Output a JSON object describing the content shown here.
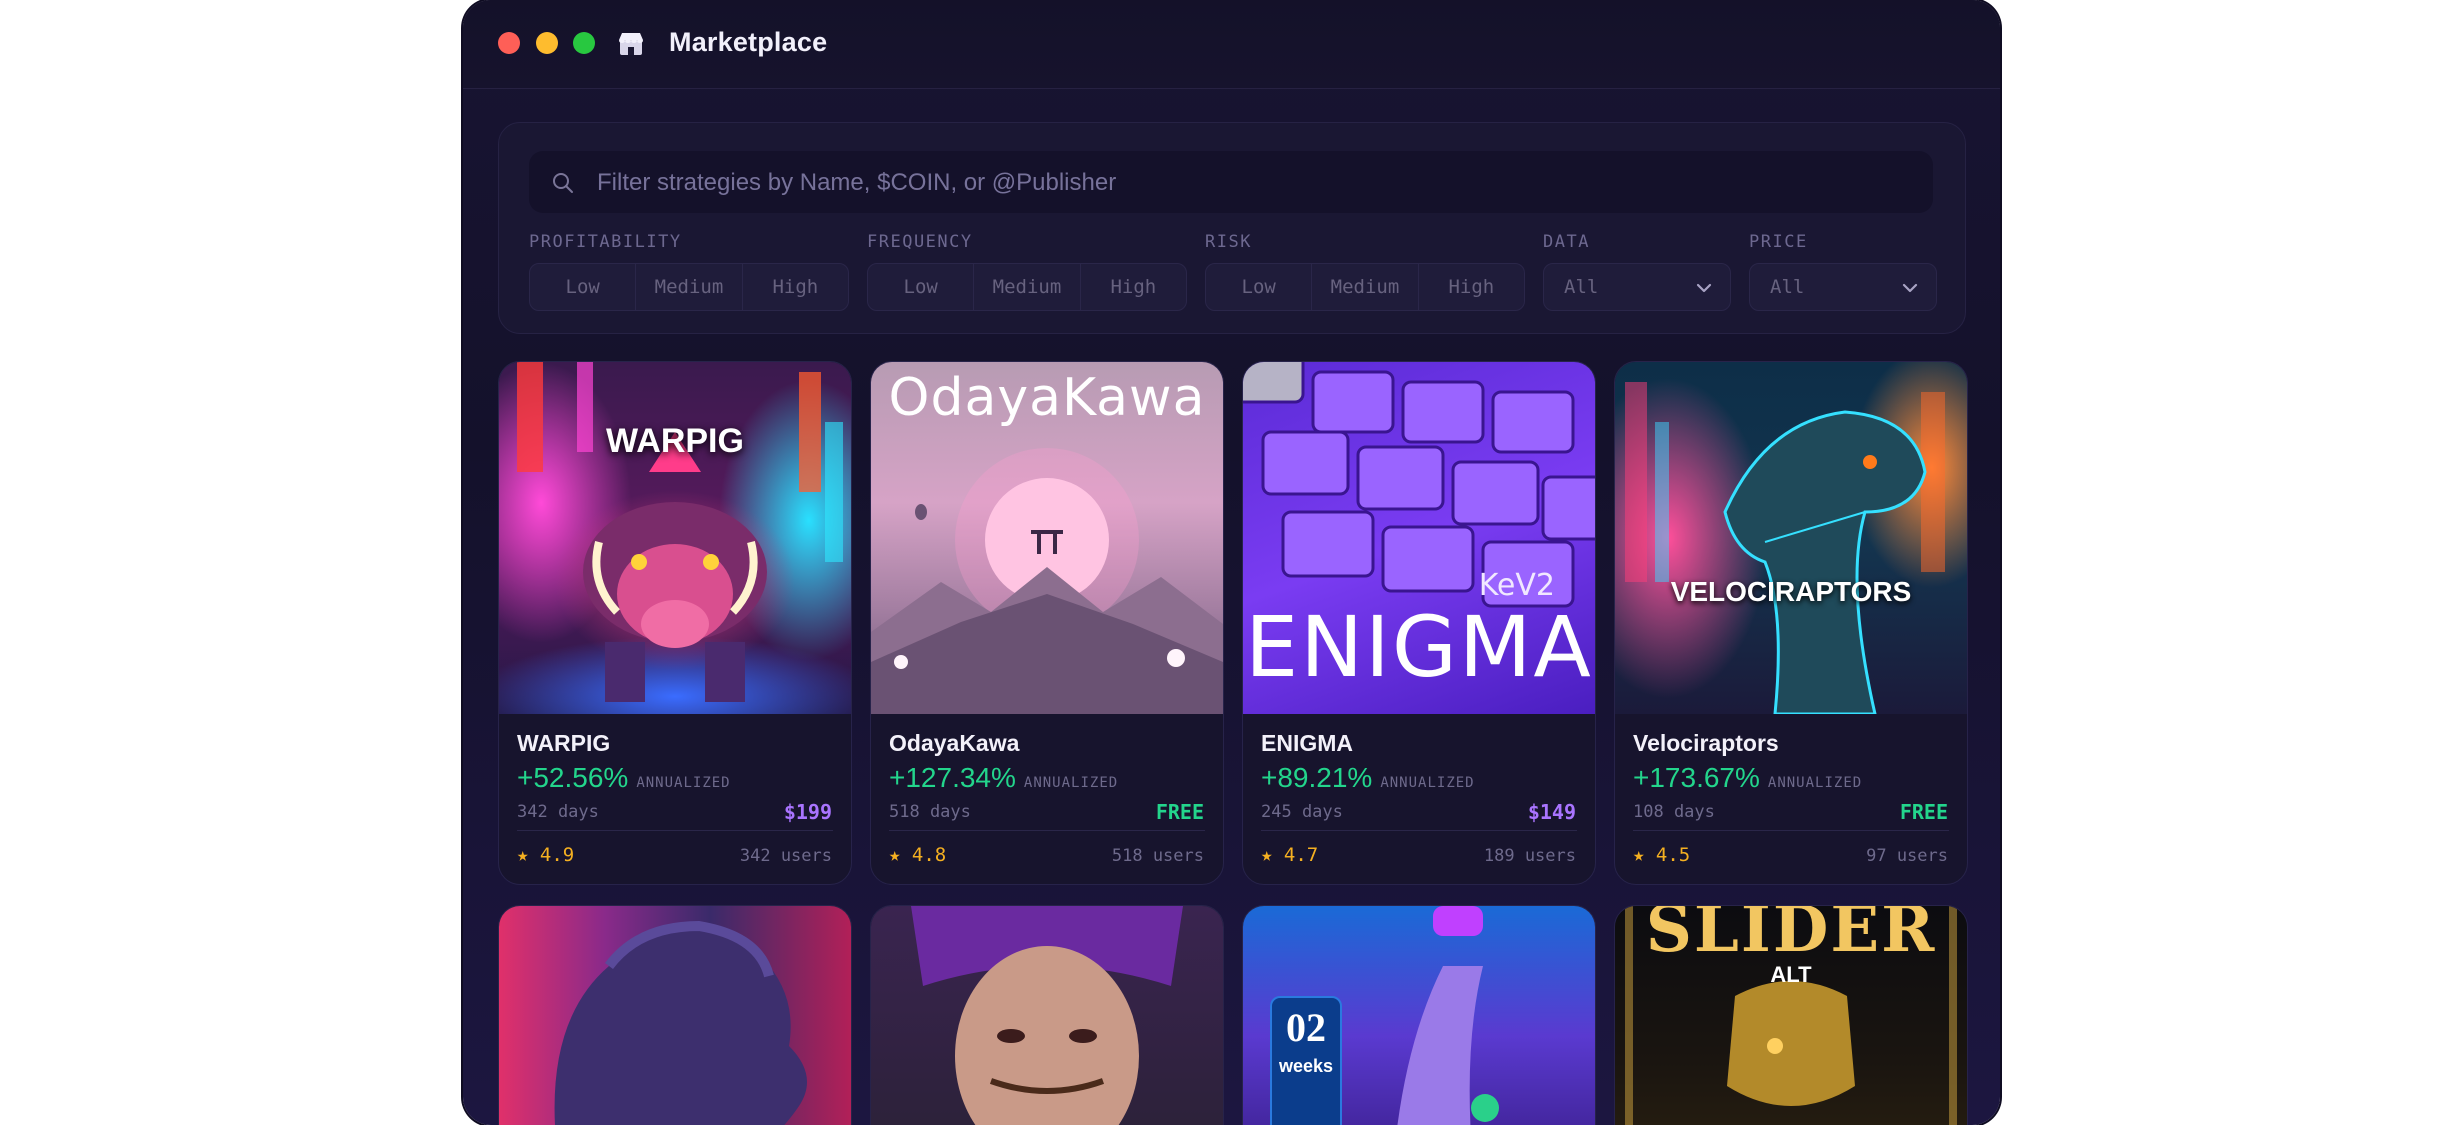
{
  "window": {
    "title": "Marketplace",
    "icon": "store-icon"
  },
  "search": {
    "placeholder": "Filter strategies by Name, $COIN, or @Publisher"
  },
  "filters": {
    "profitability": {
      "label": "PROFITABILITY",
      "options": [
        "Low",
        "Medium",
        "High"
      ]
    },
    "frequency": {
      "label": "FREQUENCY",
      "options": [
        "Low",
        "Medium",
        "High"
      ]
    },
    "risk": {
      "label": "RISK",
      "options": [
        "Low",
        "Medium",
        "High"
      ]
    },
    "data": {
      "label": "DATA",
      "value": "All"
    },
    "price": {
      "label": "PRICE",
      "value": "All"
    }
  },
  "colors": {
    "positive": "#23d58c",
    "paid_price": "#a974ff",
    "rating_star": "#f5b021",
    "window_bg": "#14112b"
  },
  "cards": [
    {
      "name": "WARPIG",
      "art_text": "WARPIG",
      "performance": "+52.56%",
      "performance_unit": "ANNUALIZED",
      "age": "342 days",
      "price": "$199",
      "rating": "★ 4.9",
      "users": "342 users"
    },
    {
      "name": "OdayaKawa",
      "art_text": "OdayaKawa",
      "performance": "+127.34%",
      "performance_unit": "ANNUALIZED",
      "age": "518 days",
      "price": "FREE",
      "rating": "★ 4.8",
      "users": "518 users"
    },
    {
      "name": "ENIGMA",
      "art_text": "ENIGMA",
      "art_subtext": "KeV2",
      "performance": "+89.21%",
      "performance_unit": "ANNUALIZED",
      "age": "245 days",
      "price": "$149",
      "rating": "★ 4.7",
      "users": "189 users"
    },
    {
      "name": "Velociraptors",
      "art_text": "VELOCIRAPTORS",
      "performance": "+173.67%",
      "performance_unit": "ANNUALIZED",
      "age": "108 days",
      "price": "FREE",
      "rating": "★ 4.5",
      "users": "97 users"
    }
  ],
  "cards_row2": [
    {
      "art": "statue-art"
    },
    {
      "art": "warrior-portrait-art"
    },
    {
      "art": "staircase-art",
      "badge_number": "02",
      "badge_unit": "weeks"
    },
    {
      "art": "slider-alt-art",
      "art_text": "SLIDER",
      "art_subtext": "ALT"
    }
  ]
}
